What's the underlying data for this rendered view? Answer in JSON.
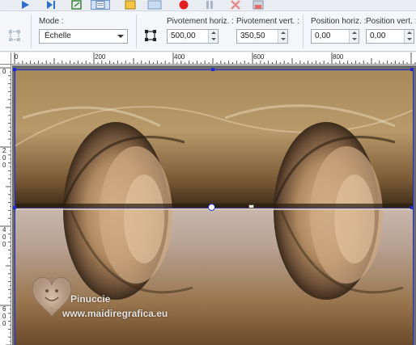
{
  "options_bar": {
    "mode_label": "Mode :",
    "mode_value": "Échelle",
    "pivot_h_label": "Pivotement horiz. :",
    "pivot_h_value": "500,00",
    "pivot_v_label": "Pivotement vert. :",
    "pivot_v_value": "350,50",
    "pos_h_label": "Position horiz. :",
    "pos_h_value": "0,00",
    "pos_v_label": "Position vert. :",
    "pos_v_value": "0,00"
  },
  "ruler": {
    "h_labels": [
      "0",
      "200",
      "400",
      "600",
      "800"
    ],
    "v_labels": [
      "0",
      "2",
      "0",
      "0",
      "4",
      "0",
      "0",
      "6",
      "0",
      "0"
    ]
  },
  "watermark": {
    "name": "Pinuccie",
    "site": "www.maidiregrafica.eu"
  },
  "colors": {
    "accent_blue": "#2a6fd0",
    "record_red": "#e02020",
    "selection_blue": "#1f2bd8"
  }
}
